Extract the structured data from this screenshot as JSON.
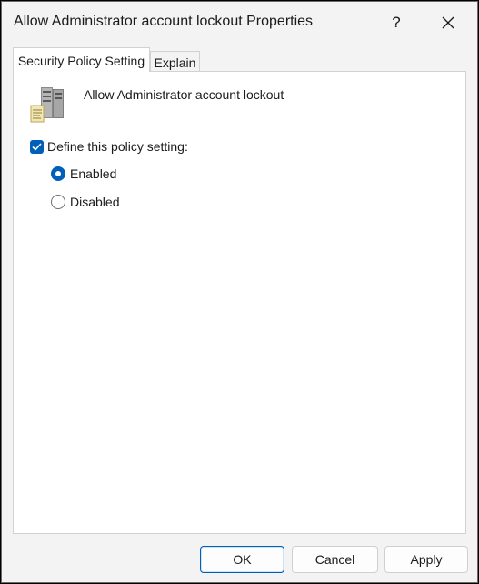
{
  "window": {
    "title": "Allow Administrator account lockout Properties"
  },
  "titlebar": {
    "help_label": "?",
    "close_icon": "close-icon"
  },
  "tabs": [
    {
      "label": "Security Policy Setting",
      "selected": true
    },
    {
      "label": "Explain",
      "selected": false
    }
  ],
  "policy": {
    "icon": "server-policy-icon",
    "name": "Allow Administrator account lockout"
  },
  "define_setting": {
    "label": "Define this policy setting:",
    "checked": true
  },
  "options": [
    {
      "label": "Enabled",
      "selected": true
    },
    {
      "label": "Disabled",
      "selected": false
    }
  ],
  "buttons": {
    "ok": "OK",
    "cancel": "Cancel",
    "apply": "Apply"
  },
  "colors": {
    "accent": "#005fb8"
  }
}
